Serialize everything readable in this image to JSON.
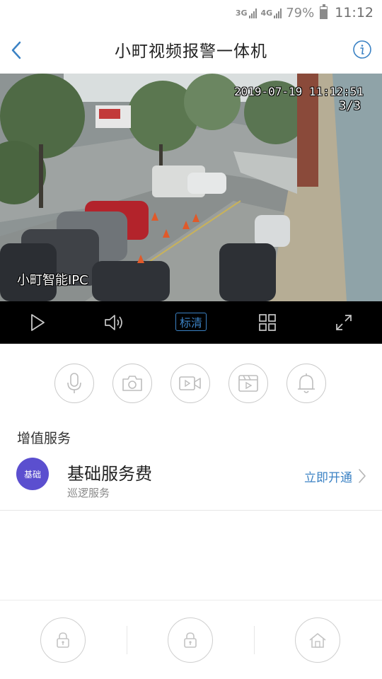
{
  "status_bar": {
    "network_1": "3G",
    "network_2": "4G",
    "battery_percent": "79%",
    "battery_level": 0.79,
    "time": "11:12"
  },
  "header": {
    "title": "小町视频报警一体机",
    "back_icon": "chevron-left-icon",
    "info_icon": "info-icon"
  },
  "video": {
    "timestamp": "2019-07-19  11:12:51",
    "channel": "3/3",
    "watermark": "小町智能IPC"
  },
  "controls": {
    "play_icon": "play-icon",
    "volume_icon": "speaker-icon",
    "quality_label": "标清",
    "grid_icon": "grid-icon",
    "fullscreen_icon": "expand-icon"
  },
  "actions": [
    {
      "icon": "microphone-icon"
    },
    {
      "icon": "camera-icon"
    },
    {
      "icon": "video-camera-icon"
    },
    {
      "icon": "playback-icon"
    },
    {
      "icon": "bell-icon"
    }
  ],
  "value_services": {
    "section_title": "增值服务",
    "items": [
      {
        "badge": "基础",
        "name": "基础服务费",
        "description": "巡逻服务",
        "cta_label": "立即开通"
      }
    ]
  },
  "bottom_nav": [
    {
      "icon": "lock-icon"
    },
    {
      "icon": "lock-icon"
    },
    {
      "icon": "home-icon"
    }
  ],
  "colors": {
    "accent": "#3b82c4",
    "badge": "#5b4fcf",
    "control_bar": "#000000"
  }
}
